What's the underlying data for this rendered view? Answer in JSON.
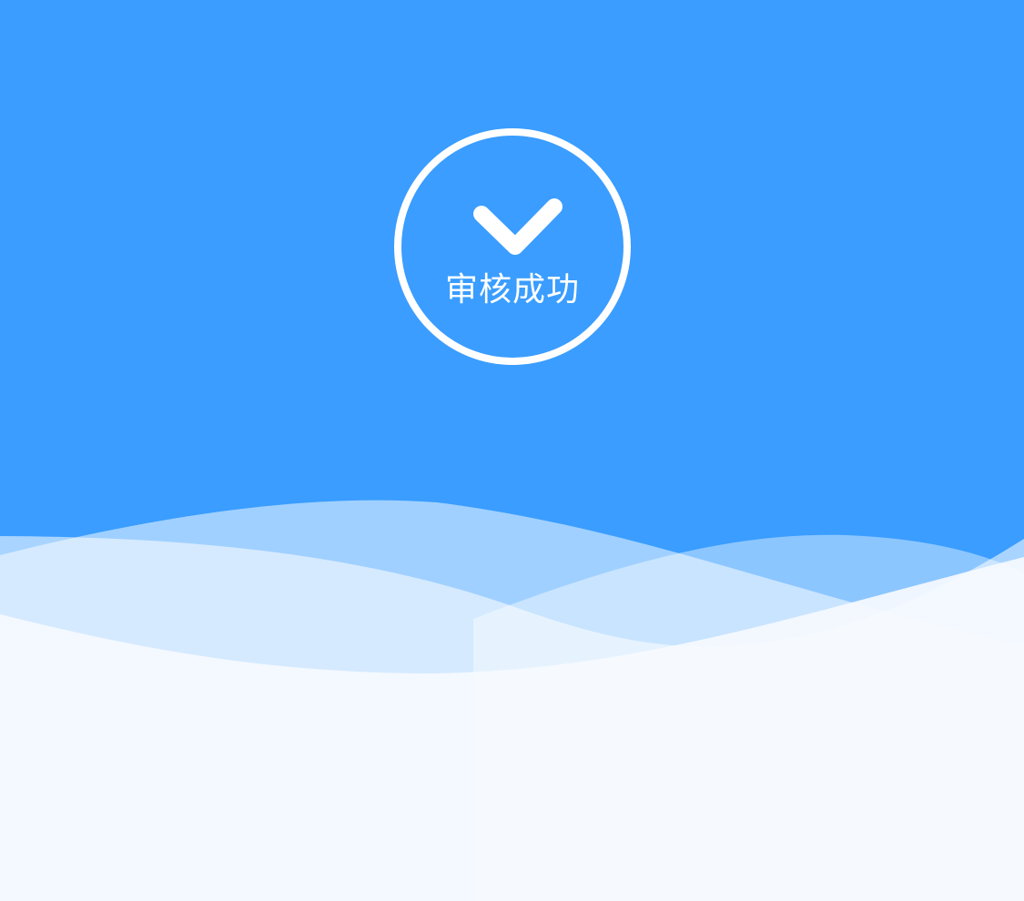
{
  "status": {
    "icon": "check-icon",
    "text": "审核成功"
  },
  "colors": {
    "background": "#3a9dff",
    "foreground": "#ffffff",
    "wave_light": "#f6faff"
  }
}
